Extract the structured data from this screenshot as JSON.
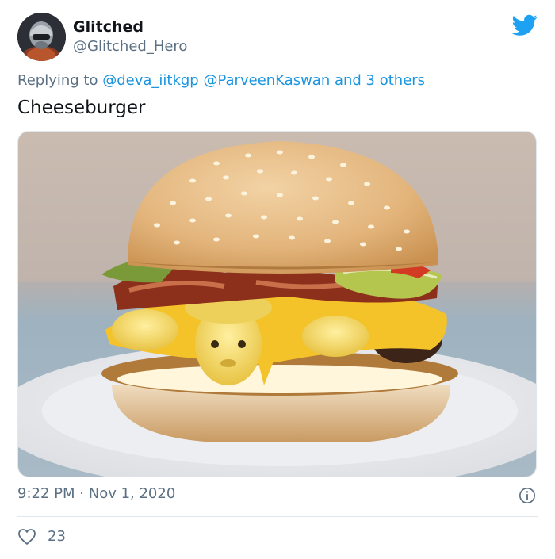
{
  "author": {
    "name": "Glitched",
    "handle": "@Glitched_Hero",
    "avatar_icon": "avatar-image"
  },
  "reply": {
    "prefix": "Replying to",
    "mentions": [
      "@deva_iitkgp",
      "@ParveenKaswan"
    ],
    "suffix": "and 3 others"
  },
  "tweet": {
    "text": "Cheeseburger",
    "media_icon": "cheeseburger-photo",
    "time": "9:22 PM",
    "separator": "·",
    "date": "Nov 1, 2020"
  },
  "actions": {
    "like_count": "23",
    "like_icon": "heart-icon",
    "info_icon": "info-icon"
  },
  "colors": {
    "link": "#1b95e0",
    "muted": "#5b7083",
    "twitter_blue": "#1da1f2"
  }
}
